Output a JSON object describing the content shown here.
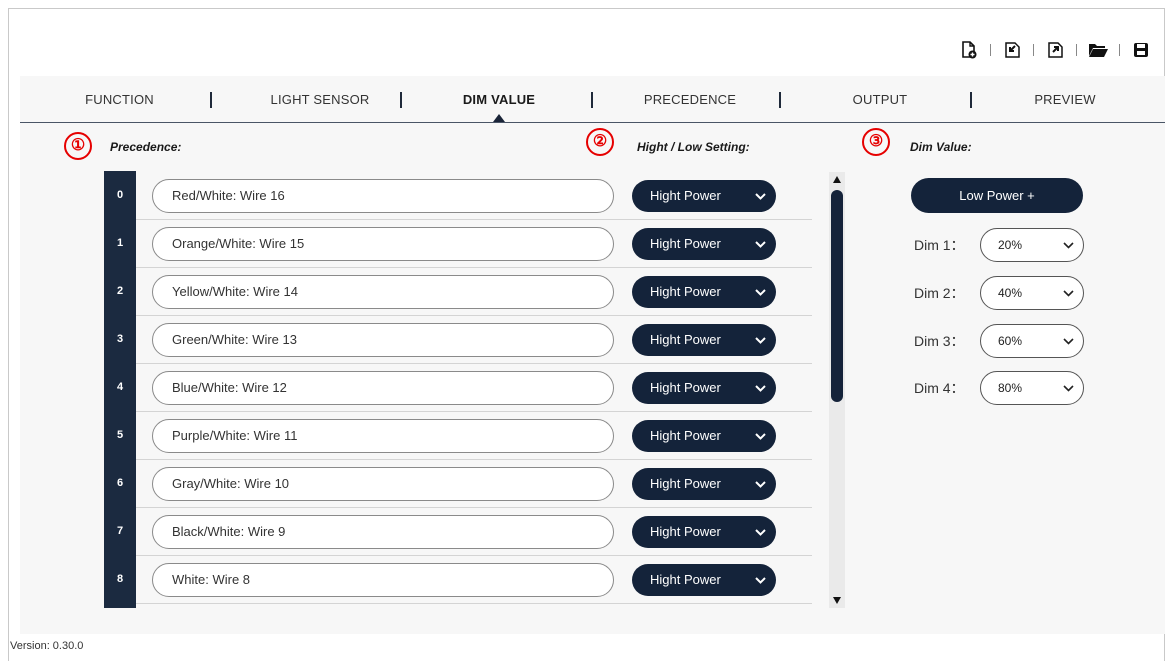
{
  "toolbar": {
    "icons": [
      "new-file-icon",
      "import-icon",
      "export-icon",
      "open-folder-icon",
      "save-icon"
    ]
  },
  "tabs": [
    {
      "label": "FUNCTION"
    },
    {
      "label": "LIGHT SENSOR"
    },
    {
      "label": "DIM VALUE"
    },
    {
      "label": "PRECEDENCE"
    },
    {
      "label": "OUTPUT"
    },
    {
      "label": "PREVIEW"
    }
  ],
  "active_tab": "DIM VALUE",
  "sections": {
    "precedence": {
      "marker": "①",
      "title": "Precedence:"
    },
    "setting": {
      "marker": "②",
      "title": "Hight / Low Setting:"
    },
    "dim": {
      "marker": "③",
      "title": "Dim Value:"
    }
  },
  "rows": [
    {
      "index": "0",
      "wire": "Red/White:  Wire 16",
      "power": "Hight Power"
    },
    {
      "index": "1",
      "wire": "Orange/White:  Wire 15",
      "power": "Hight Power"
    },
    {
      "index": "2",
      "wire": "Yellow/White:  Wire 14",
      "power": "Hight Power"
    },
    {
      "index": "3",
      "wire": "Green/White:  Wire 13",
      "power": "Hight Power"
    },
    {
      "index": "4",
      "wire": "Blue/White:  Wire 12",
      "power": "Hight Power"
    },
    {
      "index": "5",
      "wire": "Purple/White:  Wire 11",
      "power": "Hight Power"
    },
    {
      "index": "6",
      "wire": "Gray/White:  Wire 10",
      "power": "Hight Power"
    },
    {
      "index": "7",
      "wire": "Black/White:  Wire 9",
      "power": "Hight Power"
    },
    {
      "index": "8",
      "wire": "White:  Wire 8",
      "power": "Hight Power"
    }
  ],
  "dim_panel": {
    "low_power_button": "Low Power   +",
    "dims": [
      {
        "label": "Dim 1：",
        "value": "20%"
      },
      {
        "label": "Dim 2：",
        "value": "40%"
      },
      {
        "label": "Dim 3：",
        "value": "60%"
      },
      {
        "label": "Dim 4：",
        "value": "80%"
      }
    ]
  },
  "version": "Version: 0.30.0",
  "colors": {
    "accent": "#14233a",
    "marker": "#e60000",
    "index_bg": "#1b2a40"
  }
}
